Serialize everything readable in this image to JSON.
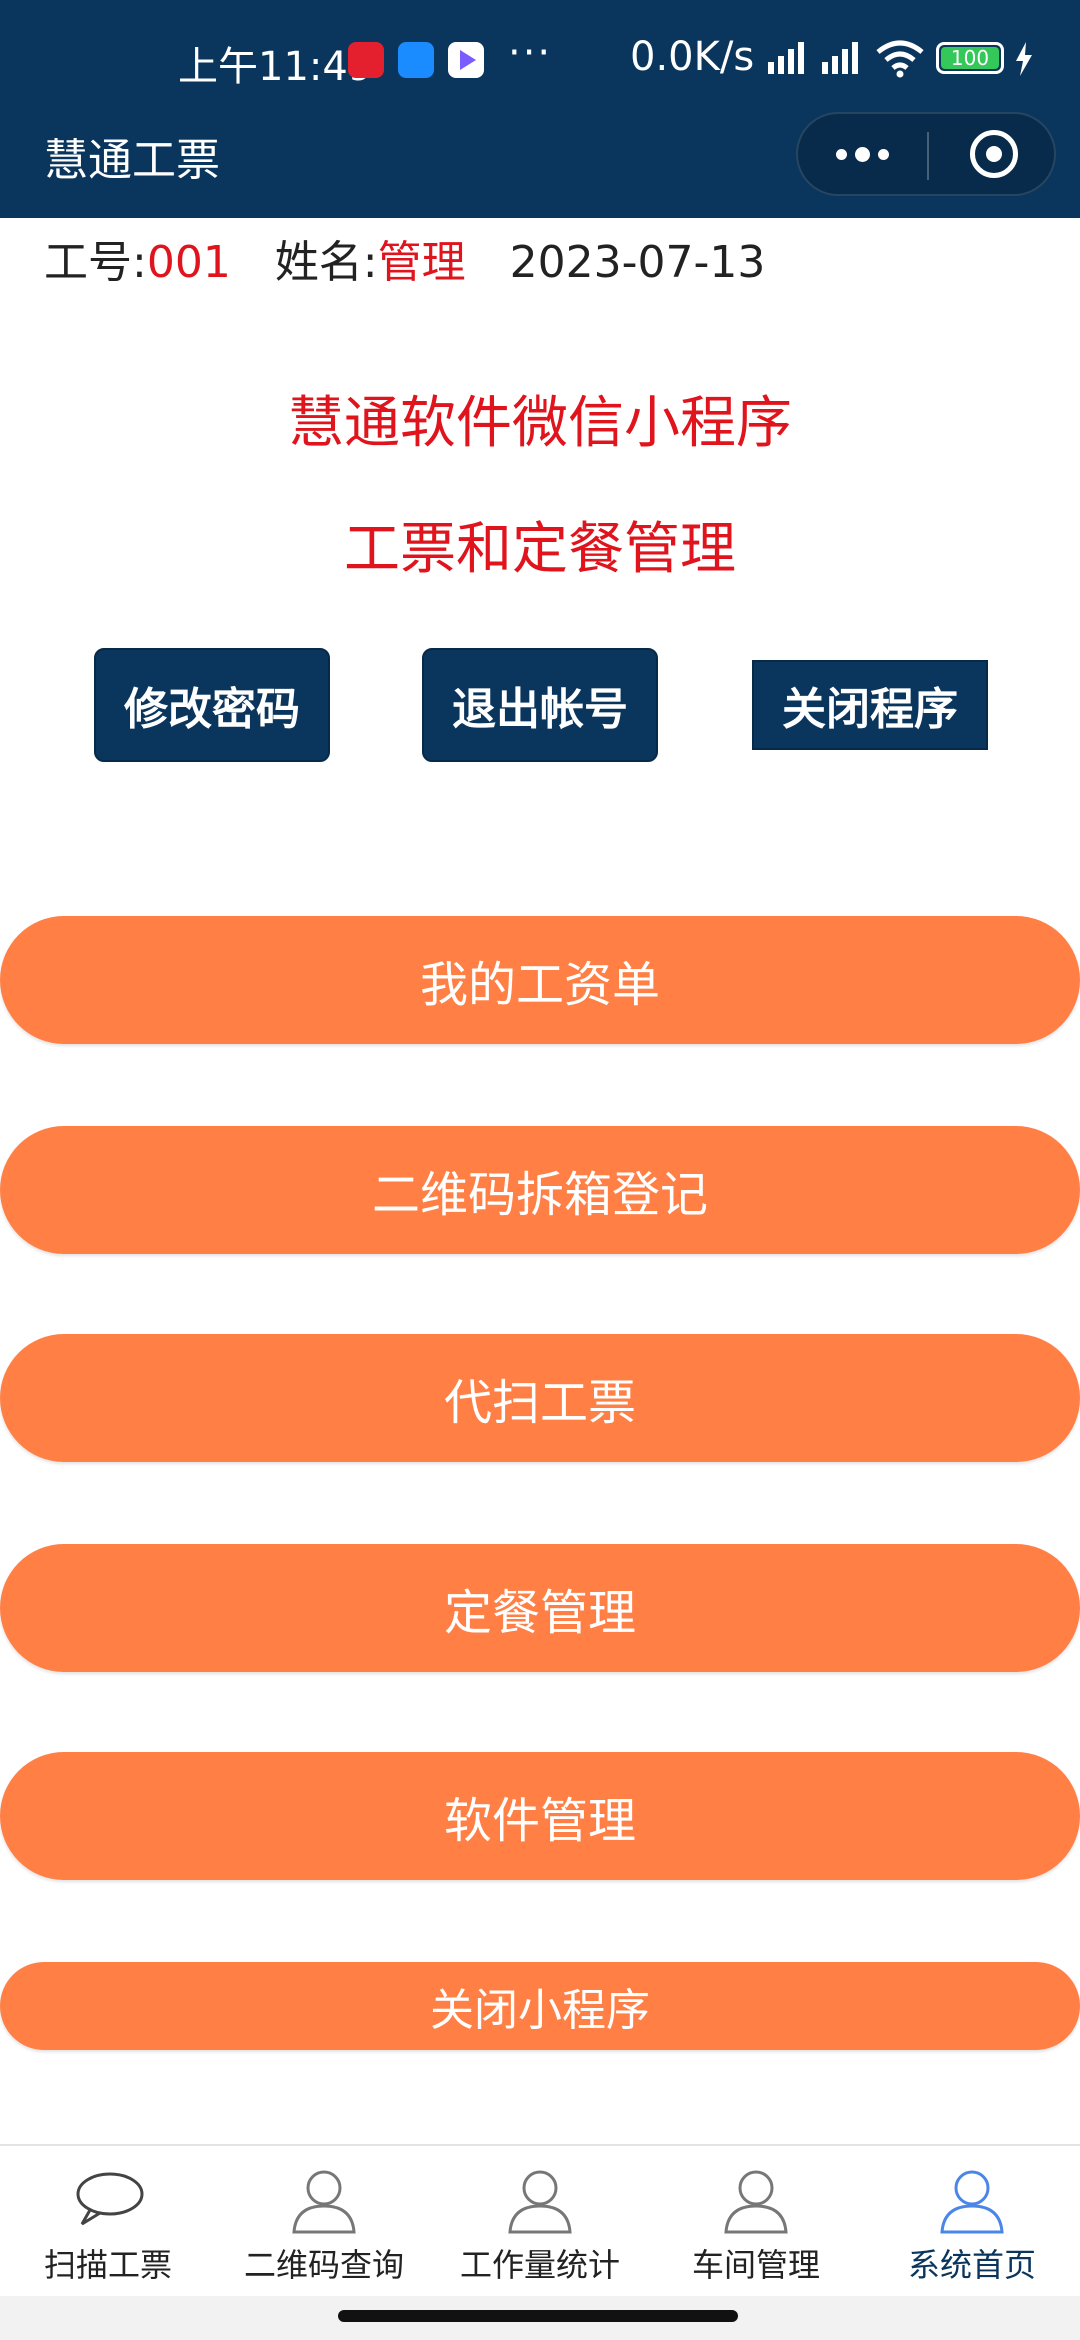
{
  "status_bar": {
    "time": "上午11:49",
    "dots": "···",
    "net_speed": "0.0K/s",
    "battery": "100"
  },
  "navbar": {
    "title": "慧通工票"
  },
  "user_info": {
    "id_label": "工号:",
    "id_value": "001",
    "name_label": "姓名:",
    "name_value": "管理",
    "date": "2023-07-13"
  },
  "headline": {
    "line1": "慧通软件微信小程序",
    "line2": "工票和定餐管理"
  },
  "actions": {
    "change_password": "修改密码",
    "logout": "退出帐号",
    "close_program": "关闭程序"
  },
  "menu": [
    "我的工资单",
    "二维码拆箱登记",
    "代扫工票",
    "定餐管理",
    "软件管理",
    "关闭小程序"
  ],
  "tabs": [
    {
      "label": "扫描工票",
      "icon": "chat-bubble-icon"
    },
    {
      "label": "二维码查询",
      "icon": "user-icon"
    },
    {
      "label": "工作量统计",
      "icon": "user-icon"
    },
    {
      "label": "车间管理",
      "icon": "user-icon"
    },
    {
      "label": "系统首页",
      "icon": "user-icon"
    }
  ],
  "colors": {
    "primary": "#0a355c",
    "accent_red": "#e0141c",
    "menu_orange": "#ff7f45",
    "active_tab_icon": "#4a86e8"
  }
}
